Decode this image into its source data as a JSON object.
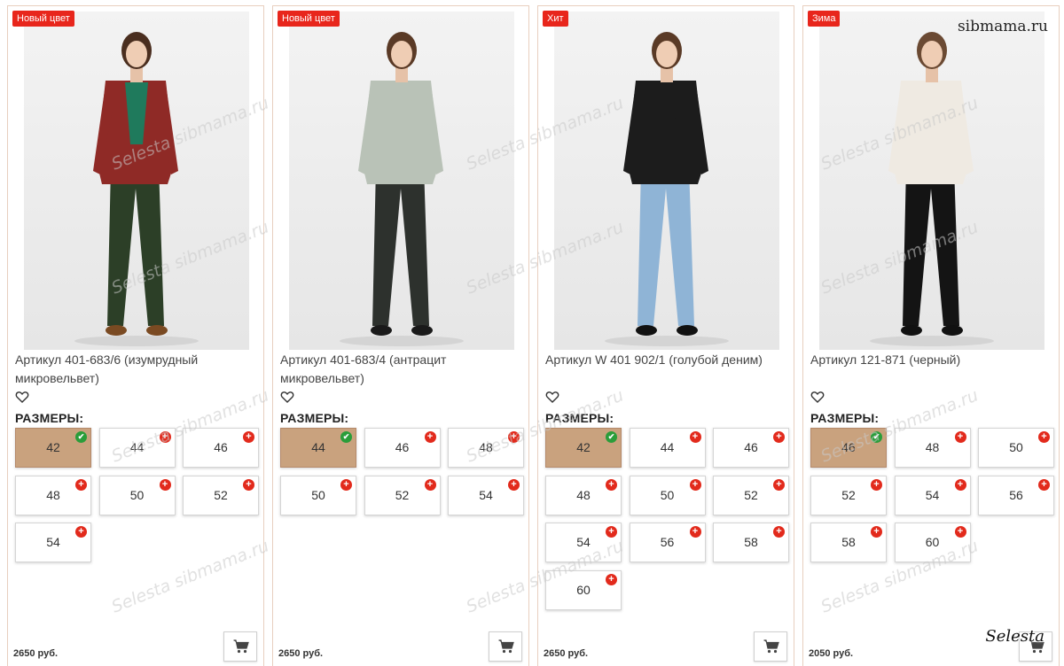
{
  "site_watermark": "sibmama.ru",
  "signature": "Selesta",
  "overlay_watermark": "Selesta sibmama.ru",
  "labels": {
    "sizes": "РАЗМЕРЫ:"
  },
  "icons": {
    "favorite": "heart-outline-icon",
    "cart": "shopping-cart-icon",
    "available": "check-circle-icon",
    "order": "plus-circle-icon"
  },
  "colors": {
    "badge": "#e8261c",
    "selected_size": "#c9a27e",
    "add_mark": "#e22a1c",
    "ok_mark": "#2a9d3a"
  },
  "products": [
    {
      "badge": "Новый цвет",
      "title": "Артикул 401-683/6 (изумрудный микровельвет)",
      "price": "2650 руб.",
      "figure": {
        "top": "#8f2a26",
        "inner": "#1f7a5c",
        "pants": "#2c3f27",
        "shoes": "#7a4a22",
        "hair": "#4a2e1f"
      },
      "sizes": [
        {
          "label": "42",
          "selected": true,
          "status": "available"
        },
        {
          "label": "44",
          "selected": false,
          "status": "order"
        },
        {
          "label": "46",
          "selected": false,
          "status": "order"
        },
        {
          "label": "48",
          "selected": false,
          "status": "order"
        },
        {
          "label": "50",
          "selected": false,
          "status": "order"
        },
        {
          "label": "52",
          "selected": false,
          "status": "order"
        },
        {
          "label": "54",
          "selected": false,
          "status": "order"
        }
      ]
    },
    {
      "badge": "Новый цвет",
      "title": "Артикул 401-683/4 (антрацит микровельвет)",
      "price": "2650 руб.",
      "figure": {
        "top": "#b9c2b7",
        "inner": "#b9c2b7",
        "pants": "#2d312d",
        "shoes": "#1a1a1a",
        "hair": "#5a3a26"
      },
      "sizes": [
        {
          "label": "44",
          "selected": true,
          "status": "available"
        },
        {
          "label": "46",
          "selected": false,
          "status": "order"
        },
        {
          "label": "48",
          "selected": false,
          "status": "order"
        },
        {
          "label": "50",
          "selected": false,
          "status": "order"
        },
        {
          "label": "52",
          "selected": false,
          "status": "order"
        },
        {
          "label": "54",
          "selected": false,
          "status": "order"
        }
      ]
    },
    {
      "badge": "Хит",
      "title": "Артикул W 401 902/1 (голубой деним)",
      "price": "2650 руб.",
      "figure": {
        "top": "#1c1c1c",
        "inner": "#1c1c1c",
        "pants": "#8fb4d6",
        "shoes": "#111111",
        "hair": "#5a3a26"
      },
      "sizes": [
        {
          "label": "42",
          "selected": true,
          "status": "available"
        },
        {
          "label": "44",
          "selected": false,
          "status": "order"
        },
        {
          "label": "46",
          "selected": false,
          "status": "order"
        },
        {
          "label": "48",
          "selected": false,
          "status": "order"
        },
        {
          "label": "50",
          "selected": false,
          "status": "order"
        },
        {
          "label": "52",
          "selected": false,
          "status": "order"
        },
        {
          "label": "54",
          "selected": false,
          "status": "order"
        },
        {
          "label": "56",
          "selected": false,
          "status": "order"
        },
        {
          "label": "58",
          "selected": false,
          "status": "order"
        },
        {
          "label": "60",
          "selected": false,
          "status": "order"
        }
      ]
    },
    {
      "badge": "Зима",
      "title": "Артикул 121-871 (черный)",
      "price": "2050 руб.",
      "figure": {
        "top": "#efeae2",
        "inner": "#efeae2",
        "pants": "#141414",
        "shoes": "#111111",
        "hair": "#6b4a33"
      },
      "sizes": [
        {
          "label": "46",
          "selected": true,
          "status": "available"
        },
        {
          "label": "48",
          "selected": false,
          "status": "order"
        },
        {
          "label": "50",
          "selected": false,
          "status": "order"
        },
        {
          "label": "52",
          "selected": false,
          "status": "order"
        },
        {
          "label": "54",
          "selected": false,
          "status": "order"
        },
        {
          "label": "56",
          "selected": false,
          "status": "order"
        },
        {
          "label": "58",
          "selected": false,
          "status": "order"
        },
        {
          "label": "60",
          "selected": false,
          "status": "order"
        }
      ]
    }
  ]
}
